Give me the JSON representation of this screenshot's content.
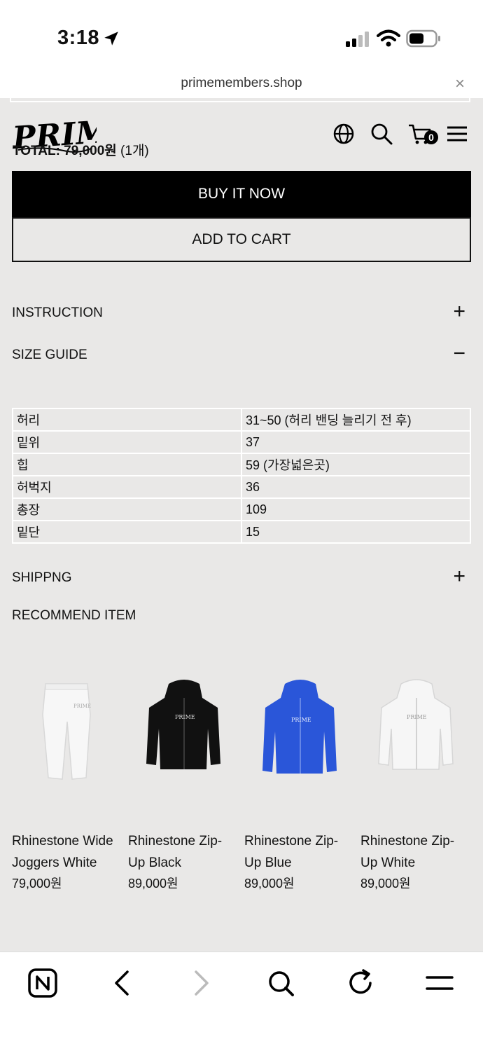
{
  "status": {
    "time": "3:18"
  },
  "browser": {
    "url": "primemembers.shop",
    "close_symbol": "×"
  },
  "header": {
    "logo_text": "PRIME",
    "total_label": "TOTAL: 79,000원",
    "total_qty": " (1개)",
    "cart_count": "0"
  },
  "actions": {
    "buy_now": "BUY IT NOW",
    "add_to_cart": "ADD TO CART"
  },
  "sections": {
    "instruction": {
      "label": "INSTRUCTION",
      "sign": "+"
    },
    "size_guide": {
      "label": "SIZE GUIDE",
      "sign": "−"
    },
    "shipping": {
      "label": "SHIPPNG",
      "sign": "+"
    }
  },
  "size_table": [
    {
      "key": "허리",
      "value": "31~50 (허리 밴딩 늘리기 전 후)"
    },
    {
      "key": "밑위",
      "value": "37"
    },
    {
      "key": "힙",
      "value": "59 (가장넓은곳)"
    },
    {
      "key": "허벅지",
      "value": "36"
    },
    {
      "key": "총장",
      "value": "109"
    },
    {
      "key": "밑단",
      "value": "15"
    }
  ],
  "recommend": {
    "title": "RECOMMEND ITEM",
    "items": [
      {
        "name": "Rhinestone Wide Joggers White",
        "price": "79,000원",
        "color": "#f6f6f6"
      },
      {
        "name": "Rhinestone Zip-Up Black",
        "price": "89,000원",
        "color": "#111111"
      },
      {
        "name": "Rhinestone Zip-Up Blue",
        "price": "89,000원",
        "color": "#2a56d9"
      },
      {
        "name": "Rhinestone Zip-Up White",
        "price": "89,000원",
        "color": "#f4f4f4"
      }
    ]
  },
  "colors": {
    "page_bg": "#e9e8e7",
    "button_dark": "#000000"
  },
  "icons": [
    "location-arrow-icon",
    "signal-icon",
    "wifi-icon",
    "battery-icon",
    "globe-icon",
    "search-icon",
    "cart-icon",
    "menu-icon",
    "n-app-icon",
    "back-icon",
    "forward-icon",
    "refresh-icon"
  ]
}
